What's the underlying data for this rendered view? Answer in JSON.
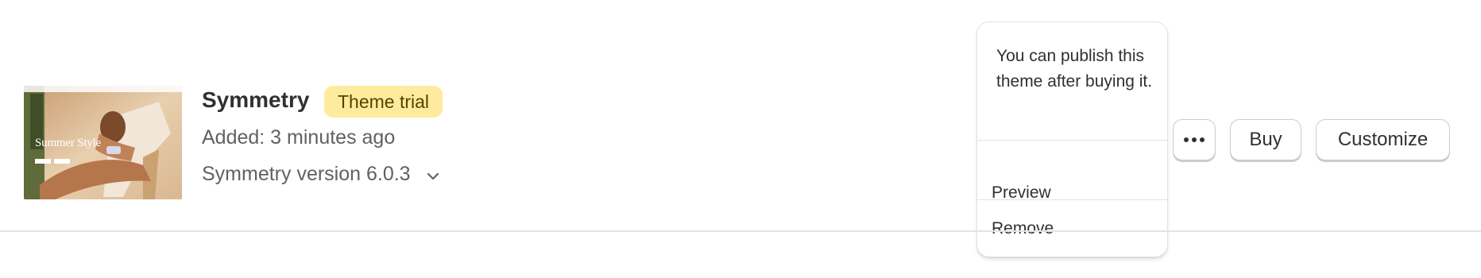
{
  "theme": {
    "name": "Symmetry",
    "badge": "Theme trial",
    "added": "Added: 3 minutes ago",
    "version": "Symmetry version 6.0.3",
    "thumbnail_caption": "Summer Style"
  },
  "popover": {
    "message": "You can publish this theme after buying it.",
    "items": [
      {
        "label": "Preview"
      },
      {
        "label": "Remove"
      }
    ]
  },
  "actions": {
    "more_icon": "ellipsis-icon",
    "buy_label": "Buy",
    "customize_label": "Customize"
  },
  "colors": {
    "badge_bg": "#ffeb9e",
    "badge_text": "#4f4700",
    "text": "#303030",
    "subdued": "#616161"
  }
}
